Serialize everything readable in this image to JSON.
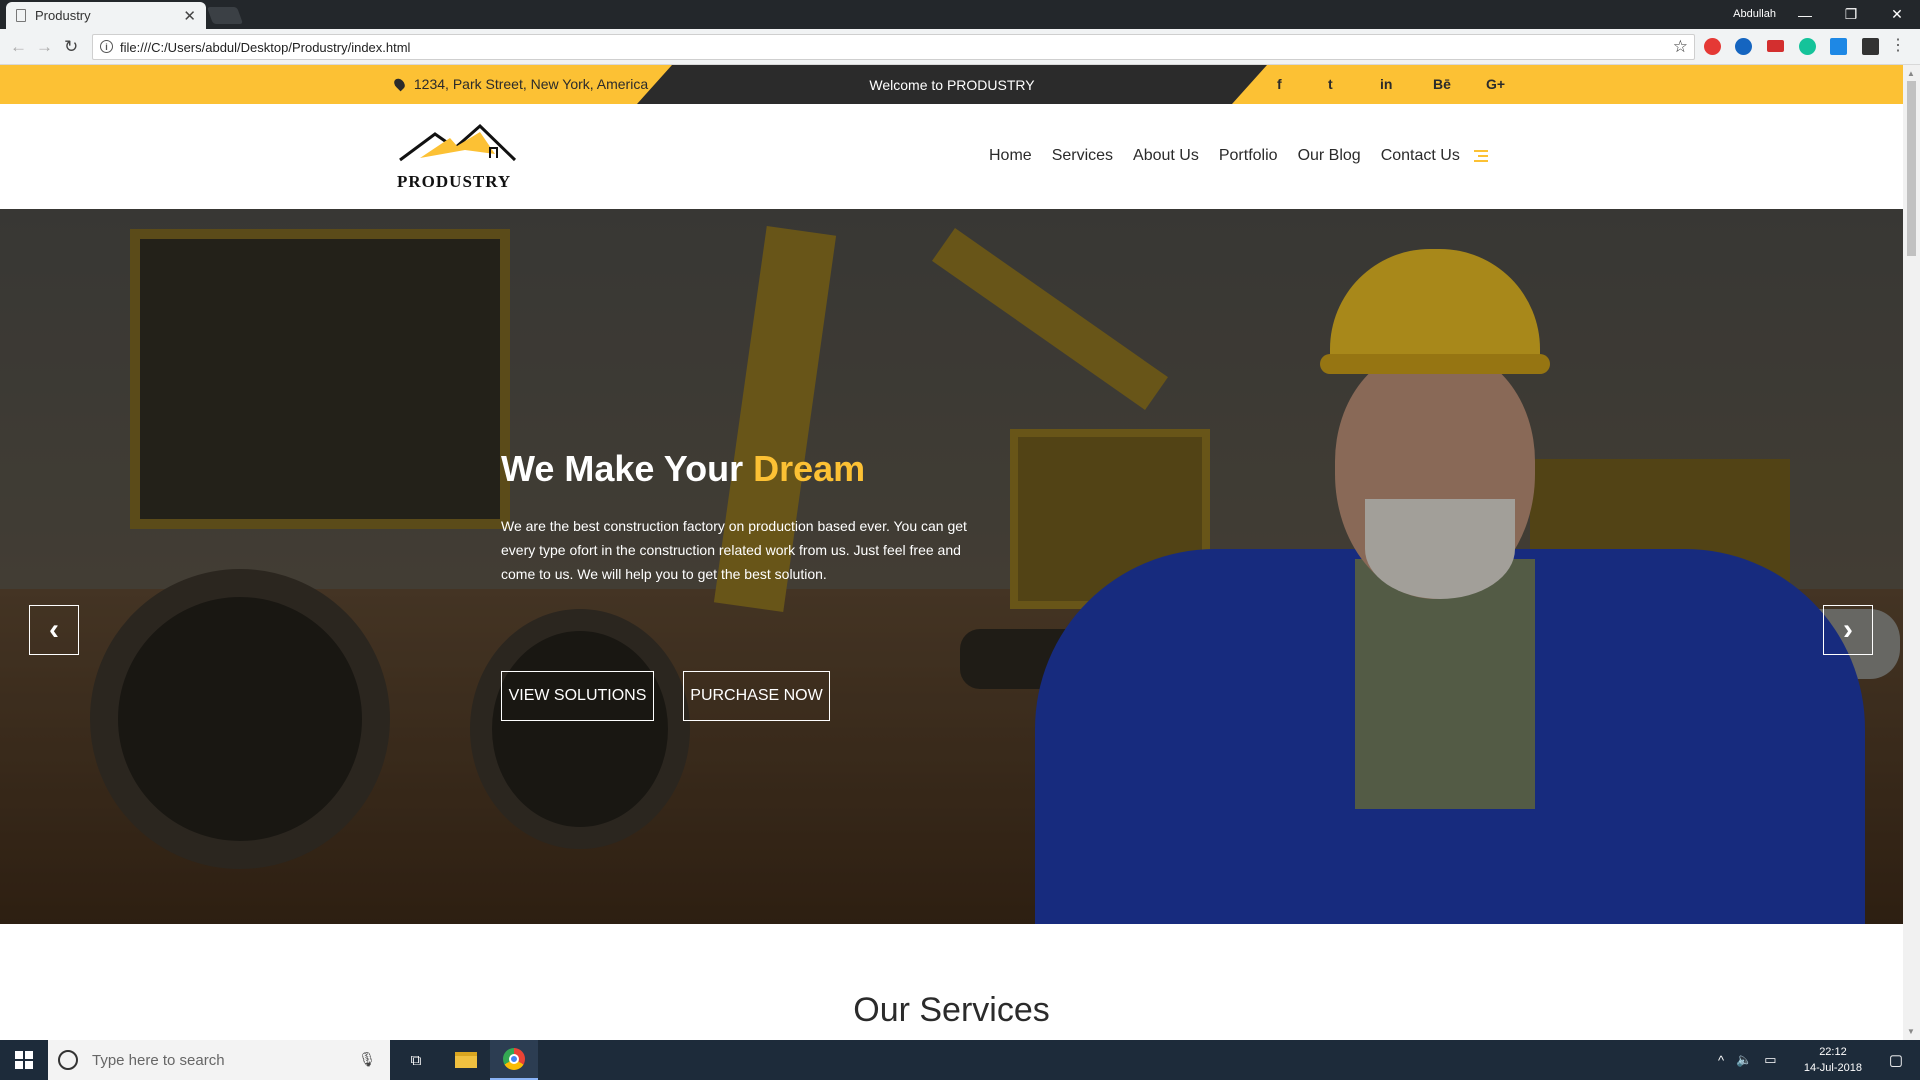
{
  "browser": {
    "tab_title": "Produstry",
    "tab_close": "✕",
    "user": "Abdullah",
    "url": "file:///C:/Users/abdul/Desktop/Produstry/index.html",
    "window_min": "—",
    "window_restore": "❐",
    "window_close": "✕"
  },
  "topbar": {
    "address": "1234, Park Street, New York, America",
    "welcome": "Welcome to PRODUSTRY",
    "social": [
      "f",
      "t",
      "in",
      "Bē",
      "G+"
    ]
  },
  "header": {
    "brand": "PRODUSTRY",
    "menu": [
      "Home",
      "Services",
      "About Us",
      "Portfolio",
      "Our Blog",
      "Contact Us"
    ]
  },
  "hero": {
    "title_main": "We Make Your ",
    "title_highlight": "Dream",
    "text": "We are the best construction factory on production based ever. You can get every type ofort in the construction related work from us. Just feel free and come to us. We will help you to get the best solution.",
    "btn_solutions": "VIEW SOLUTIONS",
    "btn_purchase": "PURCHASE NOW",
    "prev": "‹",
    "next": "›"
  },
  "section": {
    "services_title": "Our Services"
  },
  "taskbar": {
    "search_placeholder": "Type here to search",
    "time": "22:12",
    "date": "14-Jul-2018"
  },
  "colors": {
    "accent": "#fcc134",
    "dark": "#2b2b2b"
  }
}
